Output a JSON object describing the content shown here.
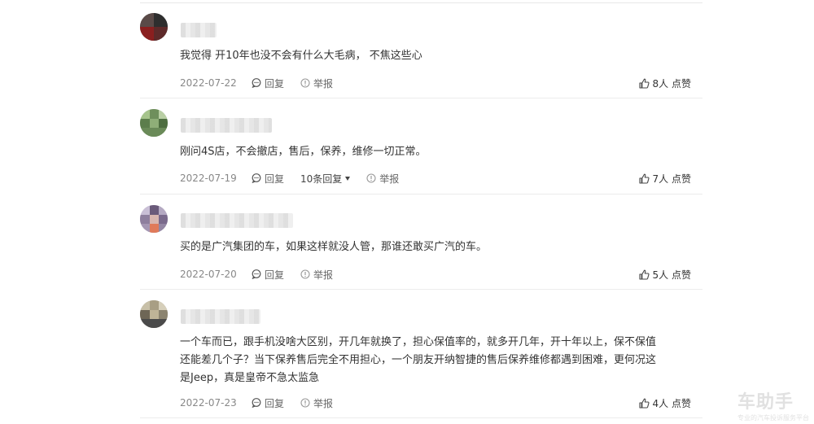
{
  "comments": [
    {
      "text": "我觉得 开10年也没不会有什么大毛病， 不焦这些心",
      "date": "2022-07-22",
      "reply_label": "回复",
      "report_label": "举报",
      "likes": "8人 点赞"
    },
    {
      "text": "刚问4S店，不会撤店，售后，保养，维修一切正常。",
      "date": "2022-07-19",
      "reply_label": "回复",
      "replies_count": "10条回复",
      "report_label": "举报",
      "likes": "7人 点赞"
    },
    {
      "text": "买的是广汽集团的车，如果这样就没人管，那谁还敢买广汽的车。",
      "date": "2022-07-20",
      "reply_label": "回复",
      "report_label": "举报",
      "likes": "5人 点赞"
    },
    {
      "text": "一个车而已，跟手机没啥大区别，开几年就换了，担心保值率的，就多开几年，开十年以上，保不保值\n还能差几个子？当下保养售后完全不用担心，一个朋友开纳智捷的售后保养维修都遇到困难，更何况这\n是Jeep，真是皇帝不急太监急",
      "date": "2022-07-23",
      "reply_label": "回复",
      "report_label": "举报",
      "likes": "4人 点赞"
    }
  ],
  "watermark": {
    "main": "车助手",
    "sub": "专业的汽车投诉服务平台"
  },
  "icons": {
    "reply": "speech-bubble-icon",
    "report": "warning-circle-icon",
    "like": "thumbs-up-icon"
  }
}
